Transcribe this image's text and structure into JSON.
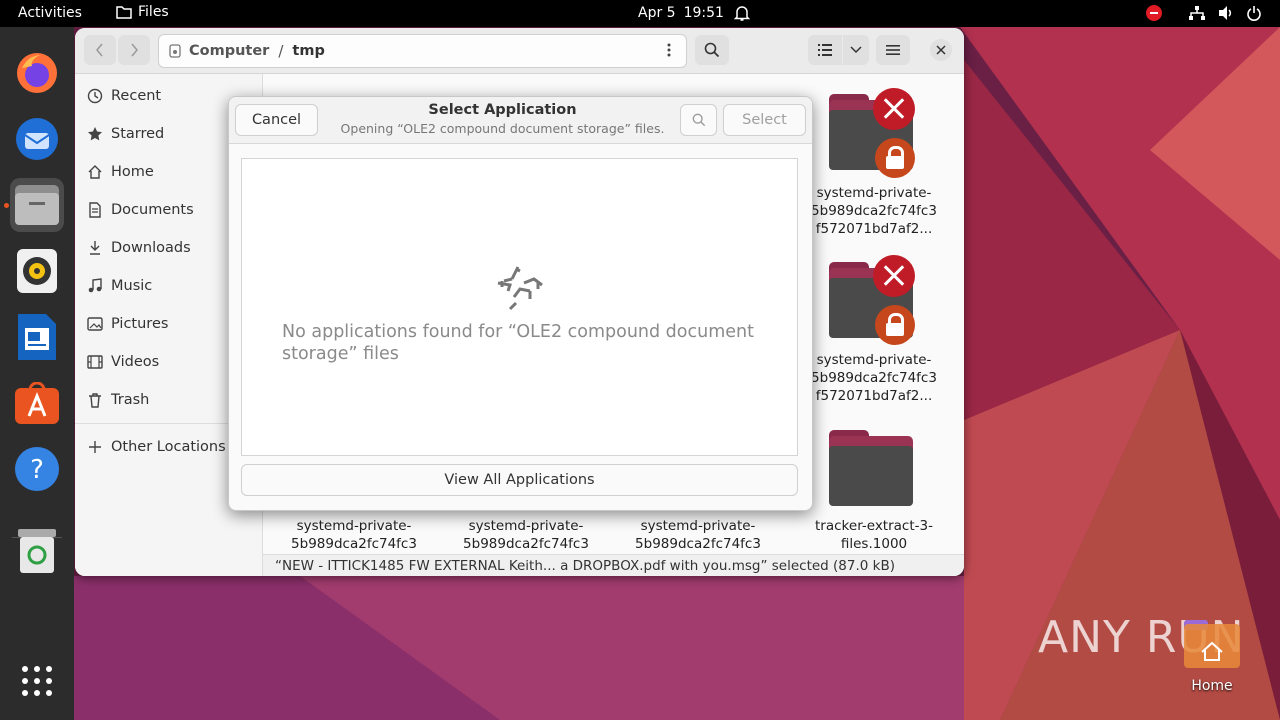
{
  "topbar": {
    "activities": "Activities",
    "app_name": "Files",
    "date": "Apr 5",
    "time": "19:51"
  },
  "dock": {
    "items": [
      "firefox",
      "thunderbird",
      "files",
      "rhythmbox",
      "libreoffice-writer",
      "app-center",
      "help",
      "trash"
    ],
    "show_apps": "show-applications"
  },
  "files_window": {
    "path": {
      "root": "Computer",
      "separator": "/",
      "current": "tmp"
    },
    "sidebar": {
      "items": [
        {
          "label": "Recent",
          "icon": "clock-icon"
        },
        {
          "label": "Starred",
          "icon": "star-icon"
        },
        {
          "label": "Home",
          "icon": "home-icon"
        },
        {
          "label": "Documents",
          "icon": "document-icon"
        },
        {
          "label": "Downloads",
          "icon": "download-icon"
        },
        {
          "label": "Music",
          "icon": "music-icon"
        },
        {
          "label": "Pictures",
          "icon": "picture-icon"
        },
        {
          "label": "Videos",
          "icon": "video-icon"
        },
        {
          "label": "Trash",
          "icon": "trash-icon"
        }
      ],
      "other_locations": "Other Locations"
    },
    "files": [
      {
        "line1": "systemd-private-",
        "line2": "5b989dca2fc74fc3",
        "line3": "f572071bd7af2..."
      },
      {
        "line1": "systemd-private-",
        "line2": "5b989dca2fc74fc3",
        "line3": "f572071bd7af2..."
      },
      {
        "line1": "tracker-extract-3-",
        "line2": "files.1000"
      },
      {
        "line1": "systemd-private-",
        "line2": "5b989dca2fc74fc3"
      },
      {
        "line1": "systemd-private-",
        "line2": "5b989dca2fc74fc3"
      },
      {
        "line1": "systemd-private-",
        "line2": "5b989dca2fc74fc3"
      }
    ],
    "status": "“NEW - ITTICK1485 FW EXTERNAL Keith... a DROPBOX.pdf with you.msg” selected (87.0 kB)"
  },
  "dialog": {
    "cancel": "Cancel",
    "title": "Select Application",
    "subtitle": "Opening “OLE2 compound document storage” files.",
    "select": "Select",
    "empty_message": "No applications found for “OLE2 compound document storage” files",
    "view_all": "View All Applications"
  },
  "desktop": {
    "watermark": "ANY RUN",
    "home_label": "Home"
  },
  "colors": {
    "accent": "#e95420",
    "error": "#c01c28",
    "lock": "#c7471c"
  }
}
